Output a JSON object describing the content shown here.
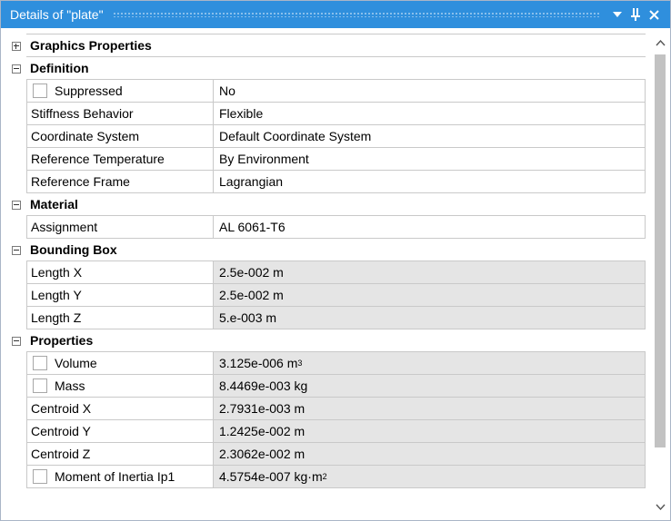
{
  "titlebar": {
    "title": "Details of \"plate\"",
    "buttons": {
      "dropdown": "chevron-down-icon",
      "pin": "pin-icon",
      "close": "close-icon"
    }
  },
  "sections": [
    {
      "id": "graphics",
      "title": "Graphics Properties",
      "expanded": false,
      "rows": []
    },
    {
      "id": "definition",
      "title": "Definition",
      "expanded": true,
      "rows": [
        {
          "label": "Suppressed",
          "value": "No",
          "checkbox": true,
          "readonly": false
        },
        {
          "label": "Stiffness Behavior",
          "value": "Flexible",
          "readonly": false
        },
        {
          "label": "Coordinate System",
          "value": "Default Coordinate System",
          "readonly": false
        },
        {
          "label": "Reference Temperature",
          "value": "By Environment",
          "readonly": false
        },
        {
          "label": "Reference Frame",
          "value": "Lagrangian",
          "readonly": false
        }
      ]
    },
    {
      "id": "material",
      "title": "Material",
      "expanded": true,
      "rows": [
        {
          "label": "Assignment",
          "value": "AL 6061-T6",
          "readonly": false
        }
      ]
    },
    {
      "id": "bounding",
      "title": "Bounding Box",
      "expanded": true,
      "rows": [
        {
          "label": "Length X",
          "value": "2.5e-002 m",
          "readonly": true
        },
        {
          "label": "Length Y",
          "value": "2.5e-002 m",
          "readonly": true
        },
        {
          "label": "Length Z",
          "value": "5.e-003 m",
          "readonly": true
        }
      ]
    },
    {
      "id": "properties",
      "title": "Properties",
      "expanded": true,
      "rows": [
        {
          "label": "Volume",
          "value": "3.125e-006 m",
          "sup": "3",
          "checkbox": true,
          "readonly": true
        },
        {
          "label": "Mass",
          "value": "8.4469e-003 kg",
          "checkbox": true,
          "readonly": true
        },
        {
          "label": "Centroid X",
          "value": "2.7931e-003 m",
          "readonly": true
        },
        {
          "label": "Centroid Y",
          "value": "1.2425e-002 m",
          "readonly": true
        },
        {
          "label": "Centroid Z",
          "value": "2.3062e-002 m",
          "readonly": true
        },
        {
          "label": "Moment of Inertia Ip1",
          "value": "4.5754e-007 kg·m",
          "sup": "2",
          "checkbox": true,
          "readonly": true
        }
      ]
    }
  ],
  "scrollbar": {
    "up": "scroll-up-icon",
    "down": "scroll-down-icon"
  },
  "colors": {
    "titlebar": "#2f8fdd",
    "readonly_bg": "#e5e5e5",
    "grid_line": "#c9c9c9"
  }
}
